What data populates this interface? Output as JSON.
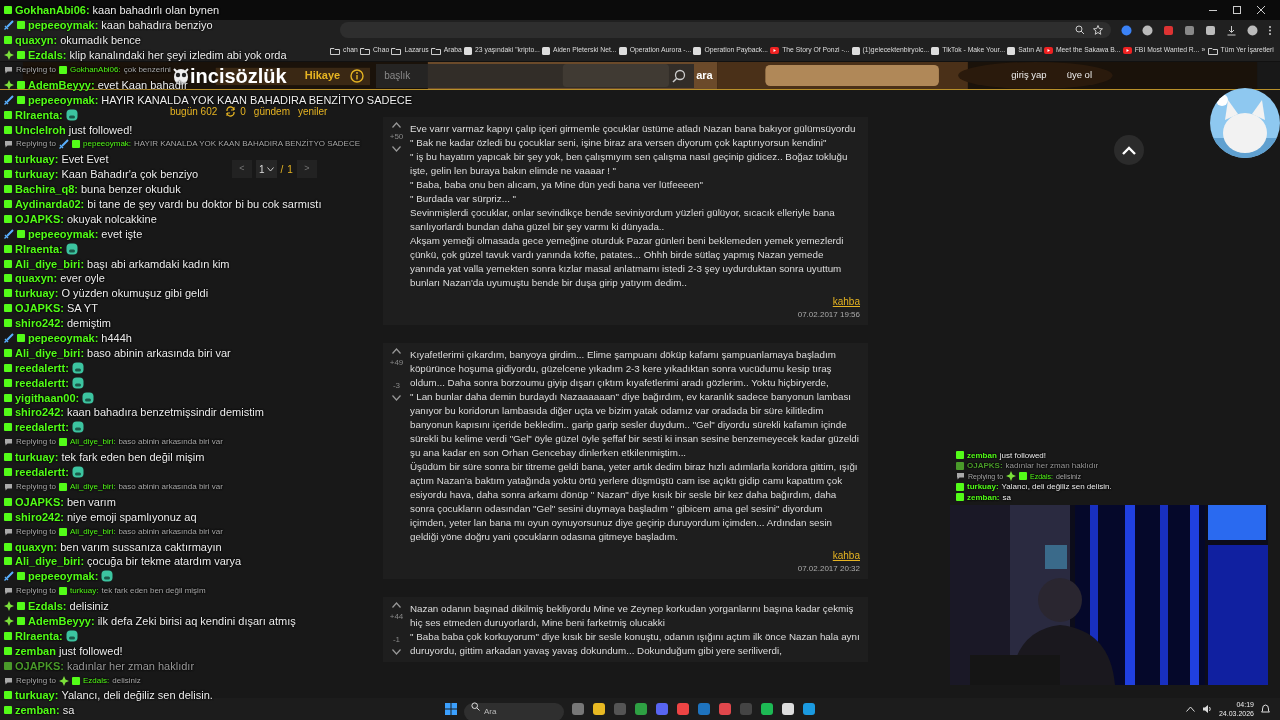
{
  "browser": {
    "bookmarks": [
      {
        "label": "chan",
        "kind": "folder"
      },
      {
        "label": "Chao",
        "kind": "folder"
      },
      {
        "label": "Lazarus",
        "kind": "folder"
      },
      {
        "label": "Araba",
        "kind": "folder"
      },
      {
        "label": "23 yaşındaki \"kripto...",
        "kind": "page"
      },
      {
        "label": "Aiden Pleterski Net...",
        "kind": "page"
      },
      {
        "label": "Operation Aurora -...",
        "kind": "page"
      },
      {
        "label": "Operation Payback...",
        "kind": "page"
      },
      {
        "label": "The Story Of Ponzi -...",
        "kind": "video"
      },
      {
        "label": "(1)gelecektenbiryolc...",
        "kind": "page"
      },
      {
        "label": "TikTok - Make Your...",
        "kind": "page"
      },
      {
        "label": "Satın Al",
        "kind": "page"
      },
      {
        "label": "Meet the Sakawa B...",
        "kind": "video"
      },
      {
        "label": "FBI Most Wanted R...",
        "kind": "video"
      },
      {
        "label": "»",
        "kind": "more"
      },
      {
        "label": "Tüm Yer İşaretleri",
        "kind": "folder"
      }
    ]
  },
  "site": {
    "logo": "incisözlük",
    "section": "Hikaye",
    "search": {
      "placeholder": "başlık"
    },
    "search_button": "ara",
    "auth": [
      "giriş yap",
      "üye ol"
    ],
    "nav": [
      {
        "kind": "link",
        "label": "bugün 602"
      },
      {
        "kind": "refresh",
        "label": "0"
      },
      {
        "kind": "link",
        "label": "gündem"
      },
      {
        "kind": "link",
        "label": "yeniler"
      }
    ],
    "pager": {
      "prev": "<",
      "page": "1",
      "separator": "/",
      "total": "1",
      "next": ">"
    },
    "entries": [
      {
        "up": "+50",
        "paragraphs": [
          "Eve varır varmaz kapıyı çalıp içeri girmemle çocuklar üstüme atladı Nazan bana bakıyor gülümsüyordu",
          "\" Bak ne kadar özledi bu çocuklar seni, işine biraz ara versen diyorum çok kaptırıyorsun kendini\"",
          "\" iş bu hayatım yapıcak bir şey yok, ben çalışmıyım sen çalışma nasıl geçinip gidicez.. Boğaz tokluğu işte, gelin len buraya bakın elimde ne vaaaar ! \"",
          "\" Baba, baba onu ben alıcam, ya Mine dün yedi bana ver lütfeeeen\"",
          "\" Burdada var sürpriz... \"",
          "Sevinmişlerdi çocuklar, onlar sevindikçe bende seviniyordum yüzleri gülüyor, sıcacık elleriyle bana sarılıyorlardı bundan daha güzel bir şey varmı ki dünyada..",
          "Akşam yemeği olmasada gece yemeğine oturduk Pazar günleri beni beklemeden yemek yemezlerdi çünkü, çok güzel tavuk vardı yanında köfte, patates... Ohhh birde sütlaç yapmış Nazan yemede yanında yat valla yemekten sonra kızlar masal anlatmamı istedi 2-3 şey uydurduktan sonra uyuttum bunları Nazan'da uyumuştu bende bir duşa girip yatıyım dedim.."
        ],
        "author": "kahba",
        "date": "07.02.2017 19:56"
      },
      {
        "up": "+49",
        "down": "-3",
        "paragraphs": [
          "Kıyafetlerimi çıkardım, banyoya girdim... Elime şampuanı döküp kafamı şampuanlamaya başladım köpürünce hoşuma gidiyordu, güzelcene yıkadım 2-3 kere yıkadıktan sonra vucüdumu kesip tıraş oldum... Daha sonra borzoumu giyip dışarı çıktım kıyafetlerimi aradı gözlerim.. Yoktu hiçbiryerde,",
          "\" Lan bunlar daha demin burdaydı Nazaaaaaan\" diye bağırdım, ev karanlık sadece banyonun lambası yanıyor bu koridorun lambasıda diğer uçta ve bizim yatak odamız var oradada bir süre kilitledim banyonun kapısını içeride bekledim.. garip garip sesler duydum.. \"Gel\" diyordu sürekli kafamın içinde sürekli bu kelime verdi \"Gel\" öyle güzel öyle şeffaf bir sesti ki insan sesine benzemeyecek kadar güzeldi şu ana kadar en son Orhan Gencebay dinlerken etkilenmiştim...",
          "Üşüdüm bir süre sonra bir titreme geldi bana, yeter artık dedim biraz hızlı adımlarla koridora gittim, ışığı açtım Nazan'a baktım yatağında yoktu örtü yerlere düşmüştü cam ise açıktı gidip camı kapattım çok esiyordu hava, daha sonra arkamı dönüp \" Nazan\" diye kısık bir sesle bir kez daha bağırdım, daha sonra çocukların odasından \"Gel\" sesini duymaya başladım \" gibicem ama gel sesini\" diyordum içimden, yeter lan bana mı oyun oynuyorsunuz diye geçirip duruyordum içimden... Ardından sesin geldiği yöne doğru yani çocukların odasına gitmeye başladım."
        ],
        "author": "kahba",
        "date": "07.02.2017 20:32"
      },
      {
        "up": "+44",
        "down": "-1",
        "paragraphs": [
          "Nazan odanın başınad dikilmiş bekliyordu Mine ve Zeynep korkudan yorganlarını başına kadar çekmiş hiç ses etmeden duruyorlardı, Mine beni farketmiş olucakki",
          "\" Baba baba çok korkuyorum\" diye kısık bir sesle konuştu, odanın ışığını açtım ilk önce Nazan hala aynı duruyordu, gittim arkadan yavaş yavaş dokundum... Dokunduğum gibi yere seriliverdi,"
        ]
      }
    ]
  },
  "chat": [
    {
      "kind": "message",
      "user": "GokhanAbi06:",
      "text": "kaan bahadırlı olan bynen",
      "dimmed": false
    },
    {
      "kind": "message",
      "badges": [
        {
          "kind": "sword"
        }
      ],
      "user": "pepeeoymak:",
      "text": "kaan bahadıra benziyo",
      "dimmed": false
    },
    {
      "kind": "message",
      "user": "quaxyn:",
      "text": "okumadık bence",
      "dimmed": false
    },
    {
      "kind": "message",
      "badges": [
        {
          "kind": "diamond"
        }
      ],
      "user": "Ezdals:",
      "text": "klip kanalındaki her şeyi izledim abi yok orda",
      "dimmed": false
    },
    {
      "kind": "reply",
      "prefix": "Replying to",
      "user": "GokhanAbi06:",
      "text": "çok benzerini"
    },
    {
      "kind": "message",
      "badges": [
        {
          "kind": "diamond"
        }
      ],
      "user": "AdemBeyyy:",
      "text": "evet Kaan bahadır",
      "dimmed": false
    },
    {
      "kind": "message",
      "badges": [
        {
          "kind": "sword"
        }
      ],
      "user": "pepeeoymak:",
      "text": "HAYIR KANALDA YOK KAAN BAHADIRA BENZİTYO SADECE",
      "dimmed": false
    },
    {
      "kind": "message",
      "user": "RIraenta:",
      "emote": true,
      "dimmed": false
    },
    {
      "kind": "follow",
      "user": "UncleIroh",
      "text": "just followed!"
    },
    {
      "kind": "reply",
      "prefix": "Replying to",
      "badges": [
        {
          "kind": "sword"
        }
      ],
      "user": "pepeeoymak:",
      "text": "HAYIR KANALDA YOK KAAN BAHADIRA BENZİTYO SADECE"
    },
    {
      "kind": "message",
      "user": "turkuay:",
      "text": "Evet Evet",
      "dimmed": false
    },
    {
      "kind": "message",
      "user": "turkuay:",
      "text": "Kaan Bahadır'a çok benziyo",
      "dimmed": false
    },
    {
      "kind": "message",
      "user": "Bachira_q8:",
      "text": "buna benzer okuduk",
      "dimmed": false
    },
    {
      "kind": "message",
      "user": "Aydinarda02:",
      "text": "bi tane de şey vardı bu doktor bi bu cok sarmıstı",
      "dimmed": false
    },
    {
      "kind": "message",
      "user": "OJAPKS:",
      "text": "okuyak nolcakkine",
      "dimmed": false
    },
    {
      "kind": "message",
      "badges": [
        {
          "kind": "sword"
        }
      ],
      "user": "pepeeoymak:",
      "text": "evet işte",
      "dimmed": false
    },
    {
      "kind": "message",
      "user": "RIraenta:",
      "emote": true,
      "dimmed": false
    },
    {
      "kind": "message",
      "user": "Ali_diye_biri:",
      "text": "başı abi arkamdaki kadın kim",
      "dimmed": false
    },
    {
      "kind": "message",
      "user": "quaxyn:",
      "text": "ever oyle",
      "dimmed": false
    },
    {
      "kind": "message",
      "user": "turkuay:",
      "text": "O yüzden okumuşuz gibi geldi",
      "dimmed": false
    },
    {
      "kind": "message",
      "user": "OJAPKS:",
      "text": "SA YT",
      "dimmed": false
    },
    {
      "kind": "message",
      "user": "shiro242:",
      "text": "demiştim",
      "dimmed": false
    },
    {
      "kind": "message",
      "badges": [
        {
          "kind": "sword"
        }
      ],
      "user": "pepeeoymak:",
      "text": "h444h",
      "dimmed": false
    },
    {
      "kind": "message",
      "user": "Ali_diye_biri:",
      "text": "baso abinin arkasında biri var",
      "dimmed": false
    },
    {
      "kind": "message",
      "user": "reedalertt:",
      "emote": true,
      "dimmed": false
    },
    {
      "kind": "message",
      "user": "reedalertt:",
      "emote": true,
      "dimmed": false
    },
    {
      "kind": "message",
      "user": "yigithaan00:",
      "emote": true,
      "dimmed": false
    },
    {
      "kind": "message",
      "user": "shiro242:",
      "text": "kaan bahadıra benzetmişsindir demistim",
      "dimmed": false
    },
    {
      "kind": "message",
      "user": "reedalertt:",
      "emote": true,
      "dimmed": false
    },
    {
      "kind": "reply",
      "prefix": "Replying to",
      "user": "Ali_diye_biri:",
      "text": "baso abinin arkasında biri var"
    },
    {
      "kind": "message",
      "user": "turkuay:",
      "text": "tek fark eden ben değil mişim",
      "dimmed": false
    },
    {
      "kind": "message",
      "user": "reedalertt:",
      "emote": true,
      "dimmed": false
    },
    {
      "kind": "reply",
      "prefix": "Replying to",
      "user": "Ali_diye_biri:",
      "text": "baso abinin arkasında biri var"
    },
    {
      "kind": "message",
      "user": "OJAPKS:",
      "text": "ben varım",
      "dimmed": false
    },
    {
      "kind": "message",
      "user": "shiro242:",
      "text": "niye emoji spamlıyonuz aq",
      "dimmed": false
    },
    {
      "kind": "reply",
      "prefix": "Replying to",
      "user": "Ali_diye_biri:",
      "text": "baso abinin arkasında biri var"
    },
    {
      "kind": "message",
      "user": "quaxyn:",
      "text": "ben varım sussanıza caktırmayın",
      "dimmed": false
    },
    {
      "kind": "message",
      "user": "Ali_diye_biri:",
      "text": "çocuğa bir tekme atardım varya",
      "dimmed": false
    },
    {
      "kind": "message",
      "badges": [
        {
          "kind": "sword"
        }
      ],
      "user": "pepeeoymak:",
      "emote": true,
      "dimmed": false
    },
    {
      "kind": "reply",
      "prefix": "Replying to",
      "user": "turkuay:",
      "text": "tek fark eden ben değil mişim"
    },
    {
      "kind": "message",
      "badges": [
        {
          "kind": "diamond"
        }
      ],
      "user": "Ezdals:",
      "text": "delisiniz",
      "dimmed": false
    },
    {
      "kind": "message",
      "badges": [
        {
          "kind": "diamond"
        }
      ],
      "user": "AdemBeyyy:",
      "text": "ilk defa Zeki birisi aq kendini dışarı atmış",
      "dimmed": false
    },
    {
      "kind": "message",
      "user": "RIraenta:",
      "emote": true,
      "dimmed": false
    },
    {
      "kind": "follow",
      "user": "zemban",
      "text": "just followed!"
    },
    {
      "kind": "message",
      "user": "OJAPKS:",
      "text": "kadınlar her zman haklıdır",
      "dimmed": true
    },
    {
      "kind": "reply",
      "prefix": "Replying to",
      "badges": [
        {
          "kind": "diamond"
        }
      ],
      "user": "Ezdals:",
      "text": "delisiniz"
    },
    {
      "kind": "message",
      "user": "turkuay:",
      "text": "Yalancı, deli değiliz sen delisin.",
      "dimmed": false
    },
    {
      "kind": "message",
      "user": "zemban:",
      "text": "sa",
      "dimmed": false
    }
  ],
  "mini_chat": [
    {
      "kind": "follow",
      "user": "zemban",
      "text": "just followed!"
    },
    {
      "kind": "message",
      "user": "OJAPKS:",
      "text": "kadınlar her zman haklıdır",
      "dimmed": true
    },
    {
      "kind": "reply",
      "prefix": "Replying to",
      "badges": [
        {
          "kind": "diamond"
        }
      ],
      "user": "Ezdals:",
      "text": "delisiniz"
    },
    {
      "kind": "message",
      "user": "turkuay:",
      "text": "Yalancı, deli değiliz sen delisin.",
      "dimmed": false
    },
    {
      "kind": "message",
      "user": "zemban:",
      "text": "sa",
      "dimmed": false
    }
  ],
  "taskbar": {
    "search": {
      "placeholder": "Ara"
    },
    "time": "04:19",
    "date": "24.03.2026"
  }
}
